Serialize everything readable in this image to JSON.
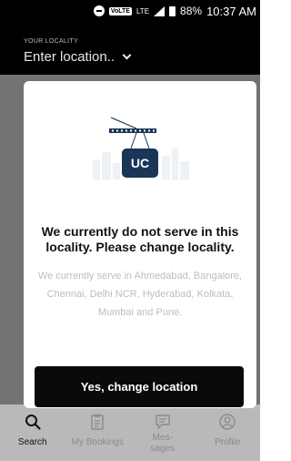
{
  "status_bar": {
    "volte": "VoLTE",
    "network": "LTE",
    "battery": "88%",
    "time": "10:37 AM"
  },
  "header": {
    "locality_label": "YOUR LOCALITY",
    "locality_value": "Enter location.."
  },
  "modal": {
    "logo_text": "UC",
    "title": "We currently do not serve in this locality. Please change locality.",
    "body": "We currently serve in Ahmedabad, Bangalore, Chennai, Delhi NCR, Hyderabad, Kolkata, Mumbai and Pune.",
    "confirm_label": "Yes, change location"
  },
  "bottom_nav": {
    "items": [
      {
        "label": "Search",
        "icon": "search-icon"
      },
      {
        "label": "My Bookings",
        "icon": "clipboard-icon"
      },
      {
        "label": "Mes-\nsages",
        "icon": "chat-icon"
      },
      {
        "label": "Profile",
        "icon": "profile-icon"
      }
    ]
  },
  "colors": {
    "dark": "#000000",
    "overlay": "#737373",
    "accent_blue": "#1a3657",
    "muted_text": "#bdbdbd"
  }
}
